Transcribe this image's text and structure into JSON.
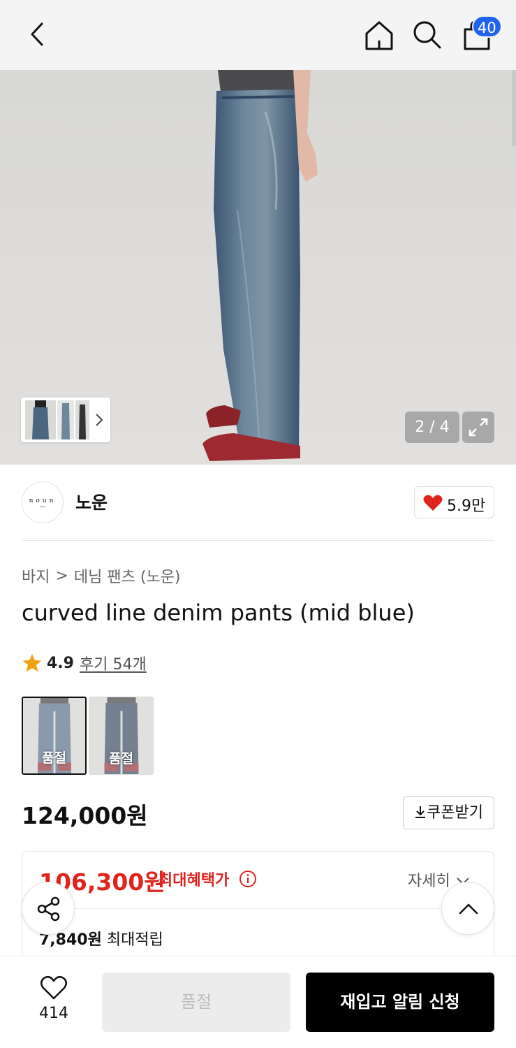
{
  "header": {
    "cart_count": "40"
  },
  "gallery": {
    "counter": "2 / 4"
  },
  "brand": {
    "logo_text": "noun",
    "name": "노운",
    "likes": "5.9만"
  },
  "breadcrumb": {
    "category": "바지",
    "subcategory": "데님 팬츠 (노운)",
    "separator": ">"
  },
  "product": {
    "title": "curved line denim pants (mid blue)",
    "rating": "4.9",
    "reviews": "후기 54개",
    "options": [
      {
        "label": "품절"
      },
      {
        "label": "품절"
      }
    ],
    "price": "124,000원",
    "coupon_label": "쿠폰받기"
  },
  "benefit": {
    "max_price": "106,300원",
    "max_label": "최대혜택가",
    "detail_label": "자세히",
    "points_amount": "7,840원",
    "points_label": "최대적립"
  },
  "bottom": {
    "wish_count": "414",
    "soldout_label": "품절",
    "restock_label": "재입고 알림 신청"
  },
  "colors": {
    "accent_red": "#e0241d",
    "badge_blue": "#1f63f0",
    "primary_black": "#000000"
  }
}
